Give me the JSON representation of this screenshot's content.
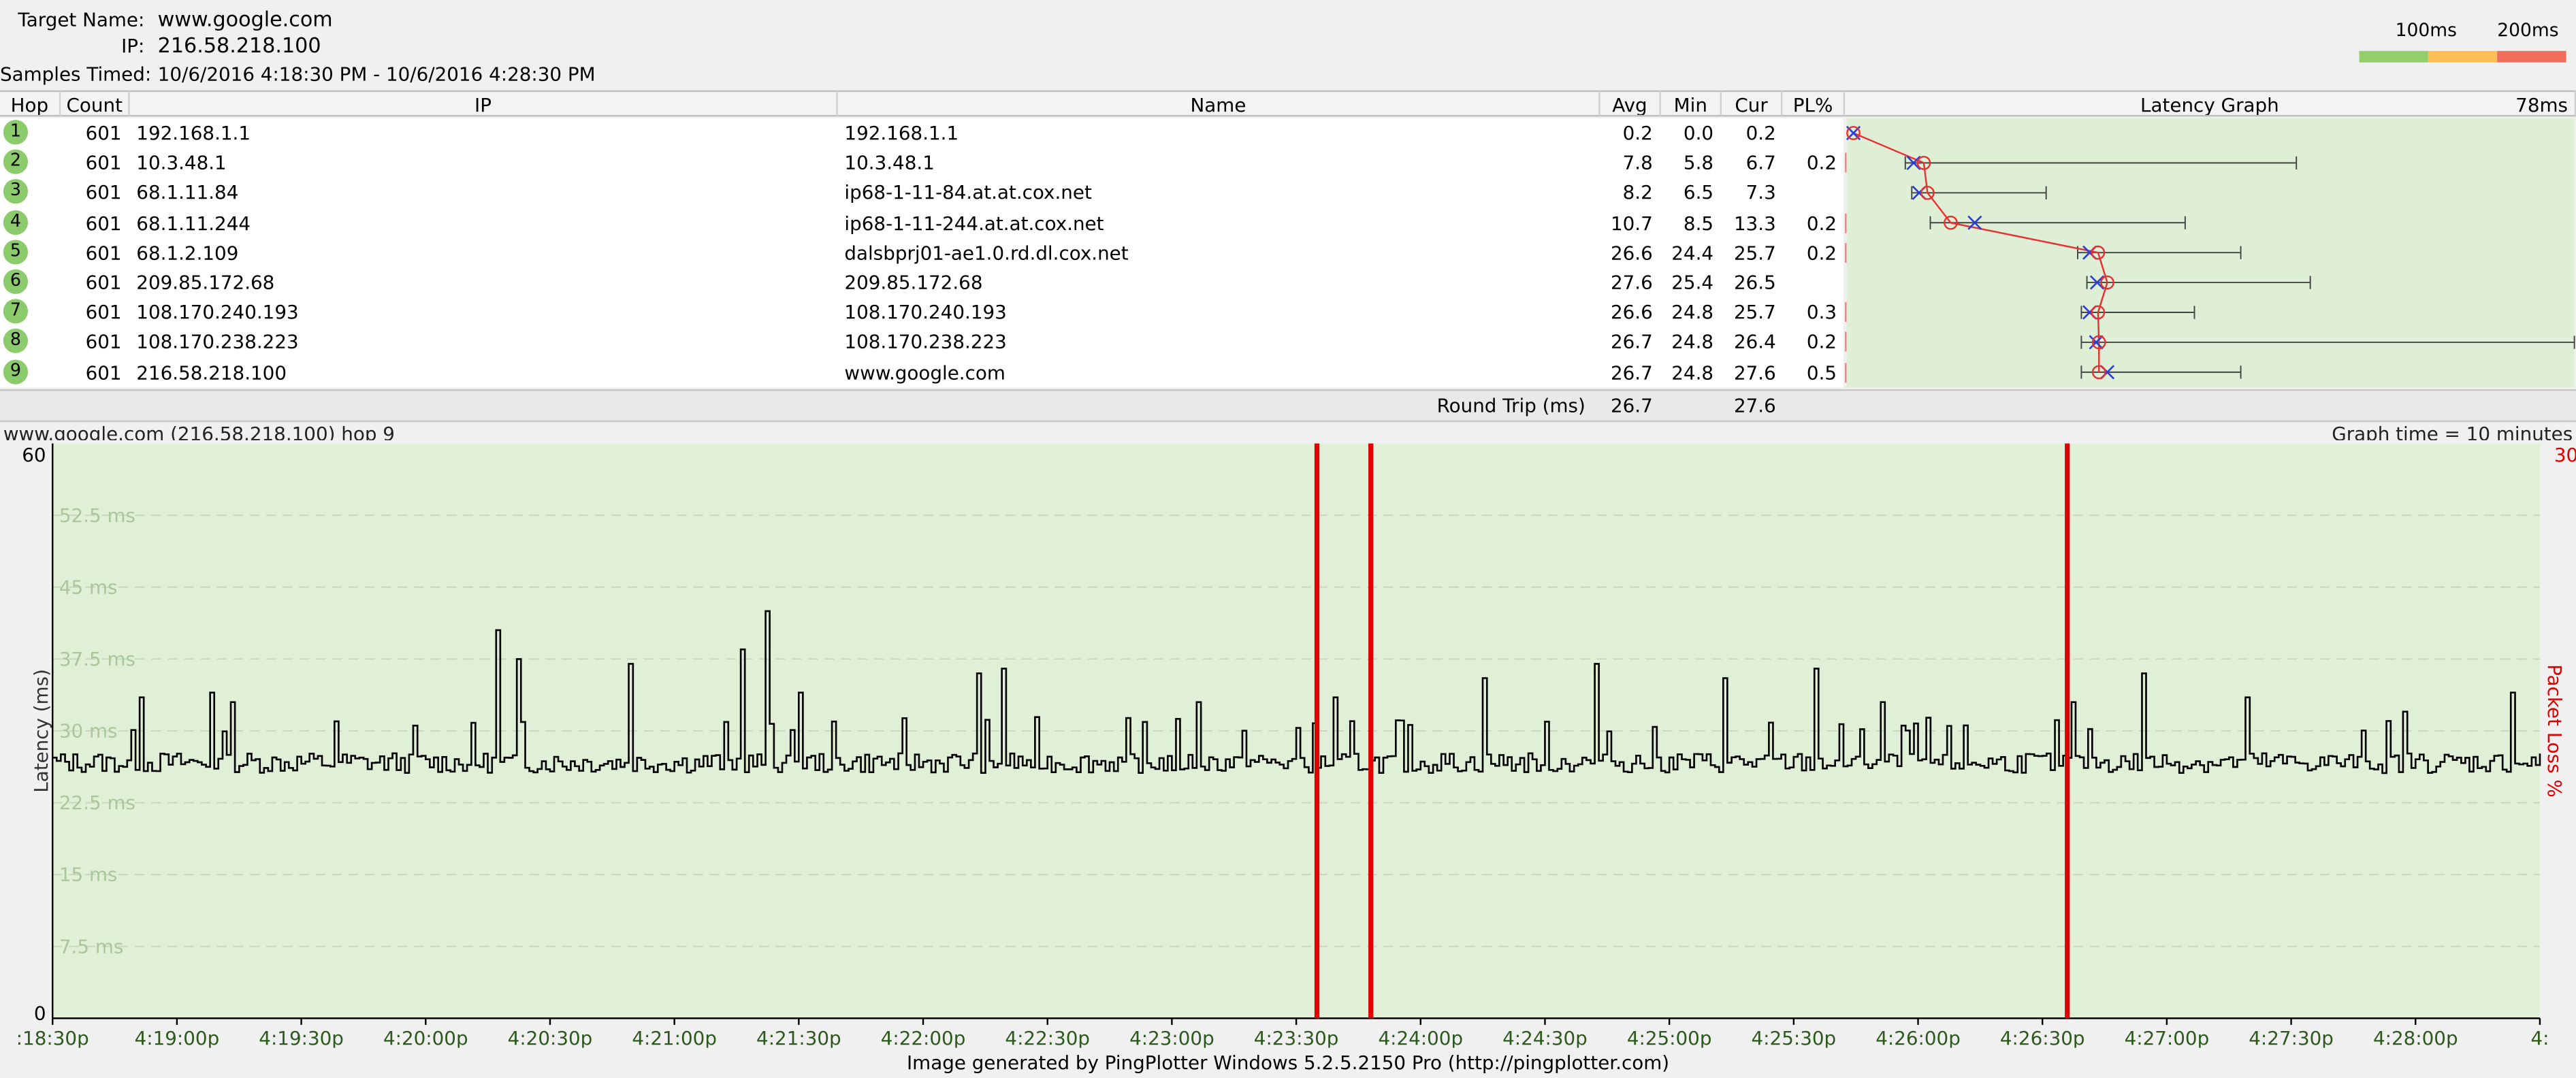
{
  "summary": {
    "target_label": "Target Name:",
    "target_value": "www.google.com",
    "ip_label": "IP:",
    "ip_value": "216.58.218.100",
    "samples_label": "Samples Timed:",
    "samples_value": "10/6/2016 4:18:30 PM - 10/6/2016 4:28:30 PM",
    "scale_100": "100ms",
    "scale_200": "200ms",
    "colors": {
      "good": "#92cf6a",
      "warn": "#ffbf55",
      "bad": "#f26d5b"
    }
  },
  "table": {
    "headers": {
      "hop": "Hop",
      "count": "Count",
      "ip": "IP",
      "name": "Name",
      "avg": "Avg",
      "min": "Min",
      "cur": "Cur",
      "pl": "PL%",
      "latency_graph": "Latency Graph",
      "latency_max": "78ms"
    },
    "rows": [
      {
        "hop": "1",
        "count": "601",
        "ip": "192.168.1.1",
        "name": "192.168.1.1",
        "avg": "0.2",
        "min": "0.0",
        "cur": "0.2",
        "pl": "",
        "pl_value": 0,
        "avg_ms": 0.2,
        "min_ms": 0.0,
        "cur_ms": 0.2,
        "max_ms": 0.6
      },
      {
        "hop": "2",
        "count": "601",
        "ip": "10.3.48.1",
        "name": "10.3.48.1",
        "avg": "7.8",
        "min": "5.8",
        "cur": "6.7",
        "pl": "0.2",
        "pl_value": 0.2,
        "avg_ms": 7.8,
        "min_ms": 5.8,
        "cur_ms": 6.7,
        "max_ms": 48.0
      },
      {
        "hop": "3",
        "count": "601",
        "ip": "68.1.11.84",
        "name": "ip68-1-11-84.at.at.cox.net",
        "avg": "8.2",
        "min": "6.5",
        "cur": "7.3",
        "pl": "",
        "pl_value": 0,
        "avg_ms": 8.2,
        "min_ms": 6.5,
        "cur_ms": 7.3,
        "max_ms": 21.0
      },
      {
        "hop": "4",
        "count": "601",
        "ip": "68.1.11.244",
        "name": "ip68-1-11-244.at.at.cox.net",
        "avg": "10.7",
        "min": "8.5",
        "cur": "13.3",
        "pl": "0.2",
        "pl_value": 0.2,
        "avg_ms": 10.7,
        "min_ms": 8.5,
        "cur_ms": 13.3,
        "max_ms": 36.0
      },
      {
        "hop": "5",
        "count": "601",
        "ip": "68.1.2.109",
        "name": "dalsbprj01-ae1.0.rd.dl.cox.net",
        "avg": "26.6",
        "min": "24.4",
        "cur": "25.7",
        "pl": "0.2",
        "pl_value": 0.2,
        "avg_ms": 26.6,
        "min_ms": 24.4,
        "cur_ms": 25.7,
        "max_ms": 42.0
      },
      {
        "hop": "6",
        "count": "601",
        "ip": "209.85.172.68",
        "name": "209.85.172.68",
        "avg": "27.6",
        "min": "25.4",
        "cur": "26.5",
        "pl": "",
        "pl_value": 0,
        "avg_ms": 27.6,
        "min_ms": 25.4,
        "cur_ms": 26.5,
        "max_ms": 49.5
      },
      {
        "hop": "7",
        "count": "601",
        "ip": "108.170.240.193",
        "name": "108.170.240.193",
        "avg": "26.6",
        "min": "24.8",
        "cur": "25.7",
        "pl": "0.3",
        "pl_value": 0.3,
        "avg_ms": 26.6,
        "min_ms": 24.8,
        "cur_ms": 25.7,
        "max_ms": 37.0
      },
      {
        "hop": "8",
        "count": "601",
        "ip": "108.170.238.223",
        "name": "108.170.238.223",
        "avg": "26.7",
        "min": "24.8",
        "cur": "26.4",
        "pl": "0.2",
        "pl_value": 0.2,
        "avg_ms": 26.7,
        "min_ms": 24.8,
        "cur_ms": 26.4,
        "max_ms": 78.0
      },
      {
        "hop": "9",
        "count": "601",
        "ip": "216.58.218.100",
        "name": "www.google.com",
        "avg": "26.7",
        "min": "24.8",
        "cur": "27.6",
        "pl": "0.5",
        "pl_value": 0.5,
        "avg_ms": 26.7,
        "min_ms": 24.8,
        "cur_ms": 27.6,
        "max_ms": 42.0
      }
    ],
    "round_trip": {
      "label": "Round Trip (ms)",
      "avg": "26.7",
      "cur": "27.6"
    },
    "latency_scale_max_ms": 78
  },
  "graph": {
    "title": "www.google.com (216.58.218.100) hop 9",
    "time_label": "Graph time = 10 minutes",
    "footer": "Image generated by PingPlotter Windows 5.2.5.2150 Pro (http://pingplotter.com)"
  },
  "chart_data": {
    "type": "line",
    "ylabel": "Latency (ms)",
    "y2label": "Packet Loss %",
    "y2_max_label": "30",
    "ylim": [
      0,
      60
    ],
    "yticks_edge": [
      "60",
      "0"
    ],
    "ygrid_labels": [
      "52.5 ms",
      "45 ms",
      "37.5 ms",
      "30 ms",
      "22.5 ms",
      "15 ms",
      "7.5 ms"
    ],
    "ygrid_values": [
      52.5,
      45,
      37.5,
      30,
      22.5,
      15,
      7.5
    ],
    "x_time_start_s": 0,
    "x_time_end_s": 600,
    "xtick_labels": [
      ":18:30p",
      "4:19:00p",
      "4:19:30p",
      "4:20:00p",
      "4:20:30p",
      "4:21:00p",
      "4:21:30p",
      "4:22:00p",
      "4:22:30p",
      "4:23:00p",
      "4:23:30p",
      "4:24:00p",
      "4:24:30p",
      "4:25:00p",
      "4:25:30p",
      "4:26:00p",
      "4:26:30p",
      "4:27:00p",
      "4:27:30p",
      "4:28:00p",
      "4:"
    ],
    "baseline_ms": 26.7,
    "spikes": [
      {
        "t": 21,
        "v": 33.5
      },
      {
        "t": 38,
        "v": 34
      },
      {
        "t": 43,
        "v": 33
      },
      {
        "t": 68,
        "v": 31
      },
      {
        "t": 107,
        "v": 40.5
      },
      {
        "t": 112,
        "v": 37.5
      },
      {
        "t": 139,
        "v": 37
      },
      {
        "t": 166,
        "v": 38.5
      },
      {
        "t": 172,
        "v": 42.5
      },
      {
        "t": 180,
        "v": 34
      },
      {
        "t": 223,
        "v": 36
      },
      {
        "t": 229,
        "v": 36.5
      },
      {
        "t": 276,
        "v": 33
      },
      {
        "t": 309,
        "v": 33.5
      },
      {
        "t": 345,
        "v": 35.5
      },
      {
        "t": 372,
        "v": 37
      },
      {
        "t": 403,
        "v": 35.5
      },
      {
        "t": 425,
        "v": 36.5
      },
      {
        "t": 441,
        "v": 33
      },
      {
        "t": 487,
        "v": 33
      },
      {
        "t": 504,
        "v": 36
      },
      {
        "t": 529,
        "v": 33.5
      },
      {
        "t": 567,
        "v": 32
      },
      {
        "t": 593,
        "v": 34
      }
    ],
    "packet_loss_events_s": [
      305,
      318,
      486
    ],
    "colors": {
      "background": "#dff0d6",
      "line": "#000000",
      "loss": "#e00000",
      "grid": "#c9d6be",
      "axis_text": "#2b5a1c"
    }
  }
}
